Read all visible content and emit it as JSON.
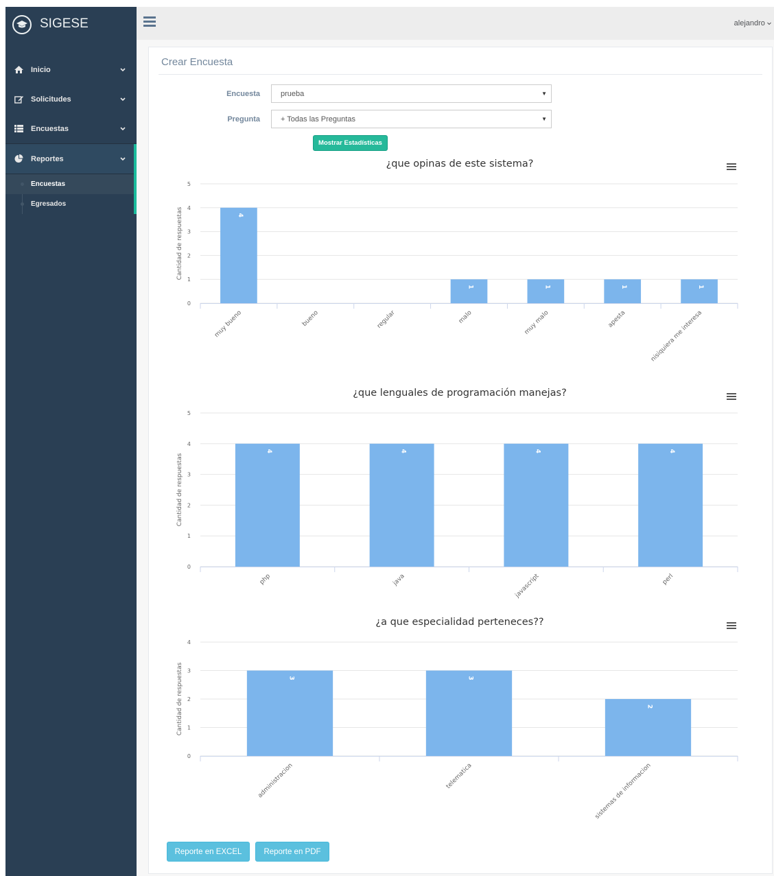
{
  "brand": {
    "title": "SIGESE",
    "logo_icon": "graduation-cap-icon"
  },
  "sidebar": {
    "items": [
      {
        "label": "Inicio",
        "icon": "home-icon"
      },
      {
        "label": "Solicitudes",
        "icon": "edit-icon"
      },
      {
        "label": "Encuestas",
        "icon": "list-icon"
      },
      {
        "label": "Reportes",
        "icon": "pie-chart-icon"
      }
    ],
    "sub_items": [
      {
        "label": "Encuestas"
      },
      {
        "label": "Egresados"
      }
    ]
  },
  "topnav": {
    "user": "alejandro"
  },
  "panel": {
    "title": "Crear Encuesta",
    "encuesta_label": "Encuesta",
    "encuesta_value": "prueba",
    "pregunta_label": "Pregunta",
    "pregunta_value": "+ Todas las Preguntas",
    "show_button": "Mostrar Estadísticas"
  },
  "chart_data": [
    {
      "type": "bar",
      "title": "¿que opinas de este sistema?",
      "ylabel": "Cantidad de respuestas",
      "categories": [
        "muy bueno",
        "bueno",
        "regular",
        "malo",
        "muy malo",
        "apesta",
        "nisiquiera me interesa"
      ],
      "values": [
        4,
        0,
        0,
        1,
        1,
        1,
        1
      ],
      "ylim": [
        0,
        5
      ],
      "yticks": [
        "0",
        "1",
        "2",
        "3",
        "4",
        "5"
      ],
      "data_labels": [
        "4",
        "",
        "",
        "1",
        "1",
        "1",
        "1"
      ],
      "grid": true,
      "color": "#7CB5EC"
    },
    {
      "type": "bar",
      "title": "¿que lenguales de programación manejas?",
      "ylabel": "Cantidad de respuestas",
      "categories": [
        "php",
        "java",
        "javascript",
        "perl"
      ],
      "values": [
        4,
        4,
        4,
        4
      ],
      "ylim": [
        0,
        5
      ],
      "yticks": [
        "0",
        "1",
        "2",
        "3",
        "4",
        "5"
      ],
      "data_labels": [
        "4",
        "4",
        "4",
        "4"
      ],
      "grid": true,
      "color": "#7CB5EC"
    },
    {
      "type": "bar",
      "title": "¿a que especialidad perteneces??",
      "ylabel": "Cantidad de respuestas",
      "categories": [
        "administracion",
        "telematica",
        "sistemas de informacion"
      ],
      "values": [
        3,
        3,
        2
      ],
      "ylim": [
        0,
        4
      ],
      "yticks": [
        "0",
        "1",
        "2",
        "3",
        "4"
      ],
      "data_labels": [
        "3",
        "3",
        "2"
      ],
      "grid": true,
      "color": "#7CB5EC"
    }
  ],
  "footer": {
    "excel": "Reporte en EXCEL",
    "pdf": "Reporte en PDF"
  },
  "colors": {
    "sidebar": "#2A3F54",
    "accent": "#1ABB9C",
    "bar": "#7CB5EC",
    "info": "#5BC0DE"
  }
}
